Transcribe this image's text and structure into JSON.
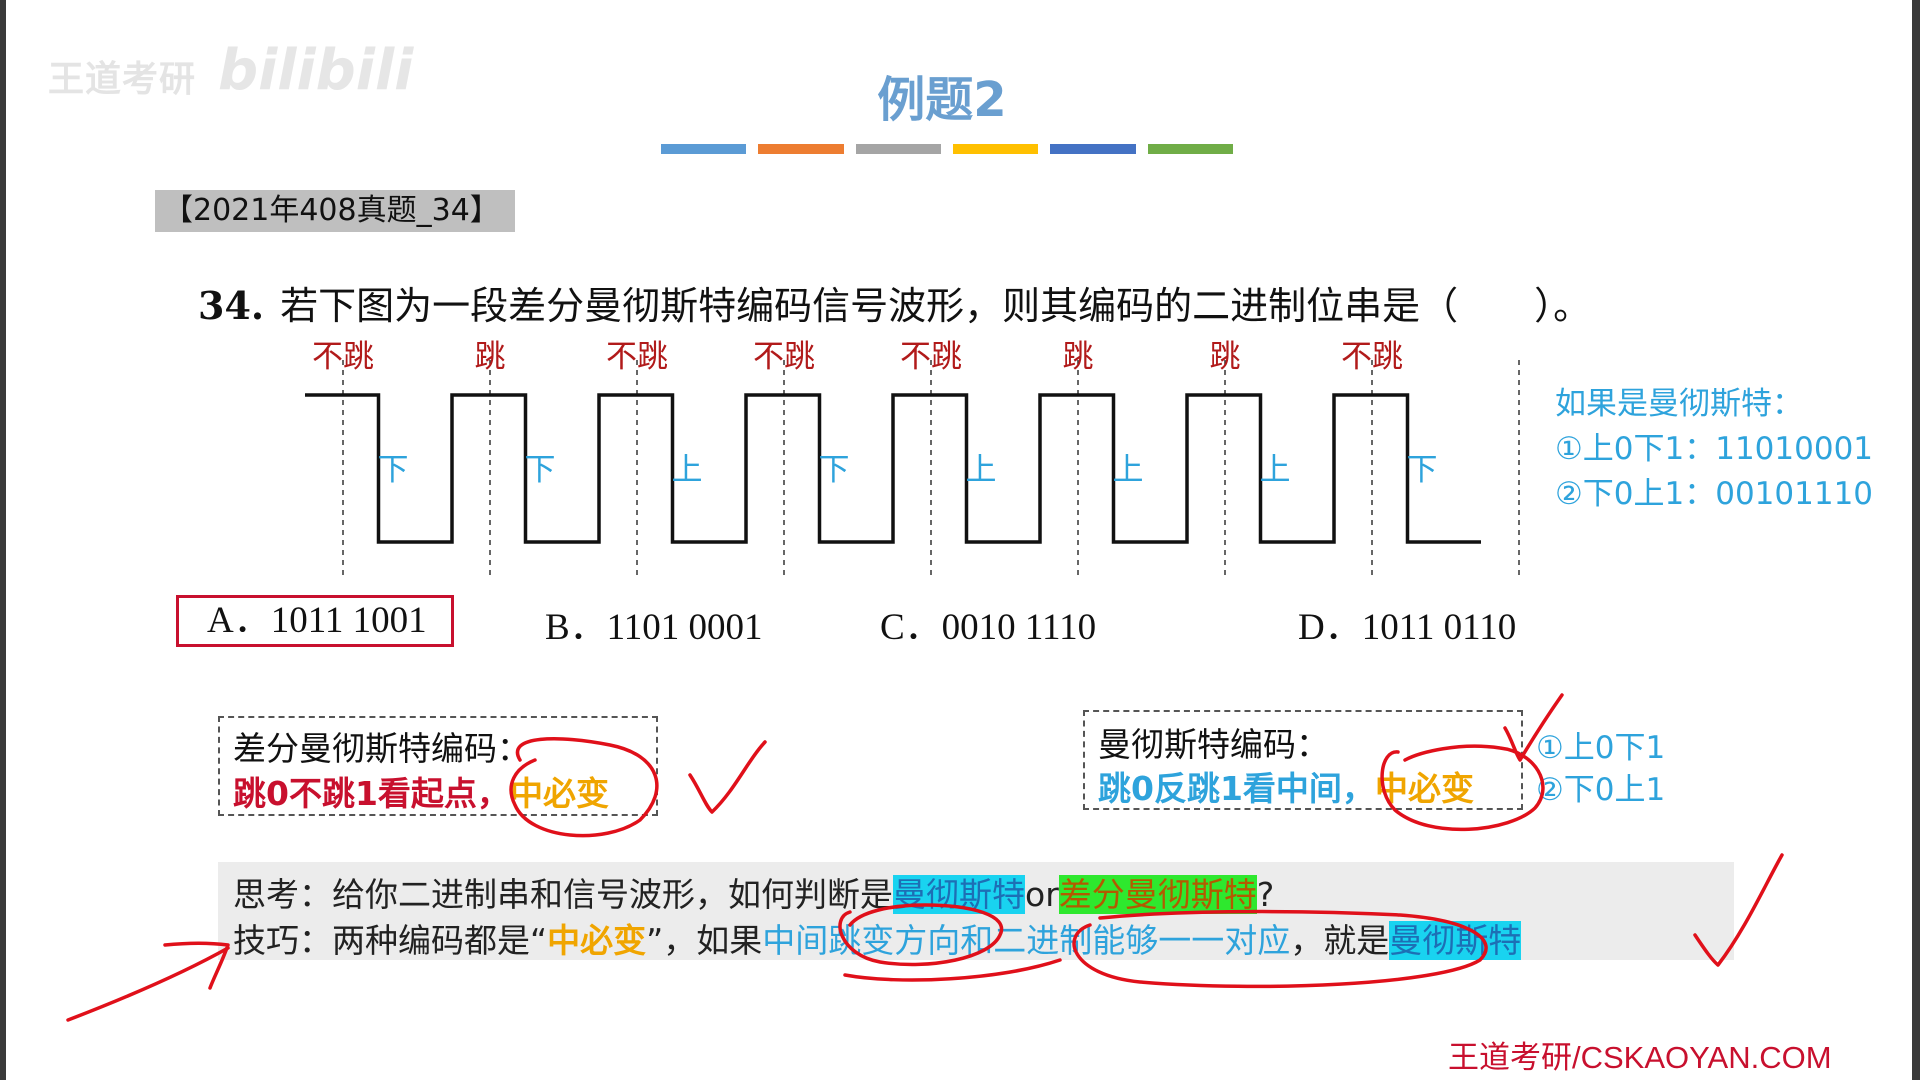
{
  "watermark": {
    "channel": "王道考研",
    "site": "bilibili"
  },
  "slide": {
    "title": "例题2",
    "color_bar": [
      "#5b9bd5",
      "#ed7d31",
      "#a5a5a5",
      "#ffc000",
      "#4472c4",
      "#70ad47"
    ],
    "exam_tag": "【2021年408真题_34】",
    "question_number": "34.",
    "question_text": "若下图为一段差分曼彻斯特编码信号波形，则其编码的二进制位串是（　　）。"
  },
  "waveform": {
    "top_labels": [
      "不跳",
      "跳",
      "不跳",
      "不跳",
      "不跳",
      "跳",
      "跳",
      "不跳"
    ],
    "mid_labels": [
      "下",
      "下",
      "上",
      "下",
      "上",
      "上",
      "上",
      "下"
    ],
    "levels": [
      "high",
      "low",
      "high",
      "low",
      "high",
      "low",
      "high",
      "low",
      "high",
      "low",
      "high",
      "low",
      "high",
      "low",
      "high",
      "low"
    ]
  },
  "options": [
    {
      "key": "A",
      "text": "A．1011 1001",
      "selected": true
    },
    {
      "key": "B",
      "text": "B．1101 0001",
      "selected": false
    },
    {
      "key": "C",
      "text": "C．0010 1110",
      "selected": false
    },
    {
      "key": "D",
      "text": "D．1011 0110",
      "selected": false
    }
  ],
  "manchester_hint": {
    "title": "如果是曼彻斯特：",
    "line1": "①上0下1：11010001",
    "line2": "②下0上1：00101110"
  },
  "box_diff": {
    "title": "差分曼彻斯特编码：",
    "rule": "跳0不跳1看起点，",
    "tail": "中必变"
  },
  "box_manchester": {
    "title": "曼彻斯特编码：",
    "rule": "跳0反跳1看中间，",
    "tail": "中必变",
    "note1": "①上0下1",
    "note2": "②下0上1"
  },
  "think": {
    "line1_prefix": "思考：给你二进制串和信号波形，如何判断是",
    "line1_hl1": "曼彻斯特",
    "line1_or": "or",
    "line1_hl2": "差分曼彻斯特",
    "line1_q": "?",
    "line2_prefix": "技巧：两种编码都是“",
    "line2_key": "中必变",
    "line2_mid": "”，如果",
    "line2_blue": "中间跳变方向和二进制能够一一对应",
    "line2_comma": "，就是",
    "line2_hl": "曼彻斯特"
  },
  "footer_logo": "王道考研/CSKAOYAN.COM"
}
